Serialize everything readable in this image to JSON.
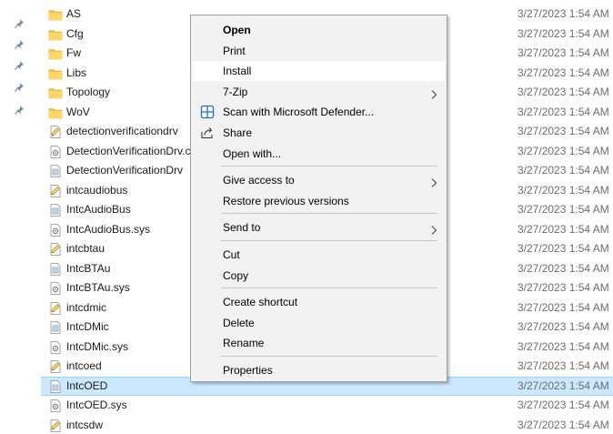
{
  "files": [
    {
      "name": "AS",
      "type": "folder",
      "date": "3/27/2023 1:54 AM"
    },
    {
      "name": "Cfg",
      "type": "folder",
      "date": "3/27/2023 1:54 AM"
    },
    {
      "name": "Fw",
      "type": "folder",
      "date": "3/27/2023 1:54 AM"
    },
    {
      "name": "Libs",
      "type": "folder",
      "date": "3/27/2023 1:54 AM"
    },
    {
      "name": "Topology",
      "type": "folder",
      "date": "3/27/2023 1:54 AM"
    },
    {
      "name": "WoV",
      "type": "folder",
      "date": "3/27/2023 1:54 AM"
    },
    {
      "name": "detectionverificationdrv",
      "type": "inf",
      "date": "3/27/2023 1:54 AM"
    },
    {
      "name": "DetectionVerificationDrv.c",
      "type": "sys",
      "date": "3/27/2023 1:54 AM"
    },
    {
      "name": "DetectionVerificationDrv",
      "type": "cat",
      "date": "3/27/2023 1:54 AM"
    },
    {
      "name": "intcaudiobus",
      "type": "inf",
      "date": "3/27/2023 1:54 AM"
    },
    {
      "name": "IntcAudioBus",
      "type": "cat",
      "date": "3/27/2023 1:54 AM"
    },
    {
      "name": "IntcAudioBus.sys",
      "type": "sys",
      "date": "3/27/2023 1:54 AM"
    },
    {
      "name": "intcbtau",
      "type": "inf",
      "date": "3/27/2023 1:54 AM"
    },
    {
      "name": "IntcBTAu",
      "type": "cat",
      "date": "3/27/2023 1:54 AM"
    },
    {
      "name": "IntcBTAu.sys",
      "type": "sys",
      "date": "3/27/2023 1:54 AM"
    },
    {
      "name": "intcdmic",
      "type": "inf",
      "date": "3/27/2023 1:54 AM"
    },
    {
      "name": "IntcDMic",
      "type": "cat",
      "date": "3/27/2023 1:54 AM"
    },
    {
      "name": "IntcDMic.sys",
      "type": "sys",
      "date": "3/27/2023 1:54 AM"
    },
    {
      "name": "intcoed",
      "type": "inf",
      "date": "3/27/2023 1:54 AM"
    },
    {
      "name": "IntcOED",
      "type": "cat",
      "date": "3/27/2023 1:54 AM",
      "selected": true
    },
    {
      "name": "IntcOED.sys",
      "type": "sys",
      "date": "3/27/2023 1:54 AM"
    },
    {
      "name": "intcsdw",
      "type": "inf",
      "date": "3/27/2023 1:54 AM"
    }
  ],
  "context_menu": {
    "items": [
      {
        "label": "Open",
        "bold": true
      },
      {
        "label": "Print"
      },
      {
        "label": "Install",
        "hover": true
      },
      {
        "label": "7-Zip",
        "submenu": true
      },
      {
        "label": "Scan with Microsoft Defender...",
        "icon": "defender-shield-icon"
      },
      {
        "label": "Share",
        "icon": "share-icon"
      },
      {
        "label": "Open with..."
      },
      {
        "separator": true
      },
      {
        "label": "Give access to",
        "submenu": true
      },
      {
        "label": "Restore previous versions"
      },
      {
        "separator": true
      },
      {
        "label": "Send to",
        "submenu": true
      },
      {
        "separator": true
      },
      {
        "label": "Cut"
      },
      {
        "label": "Copy"
      },
      {
        "separator": true
      },
      {
        "label": "Create shortcut"
      },
      {
        "label": "Delete"
      },
      {
        "label": "Rename"
      },
      {
        "separator": true
      },
      {
        "label": "Properties"
      }
    ]
  },
  "colors": {
    "selection_bg": "#cce8ff",
    "selection_border": "#99d1ff",
    "menu_bg": "#f2f2f2",
    "folder_yellow": "#f5c24c",
    "date_gray": "#6d6d6d"
  },
  "pinned_count": 5
}
